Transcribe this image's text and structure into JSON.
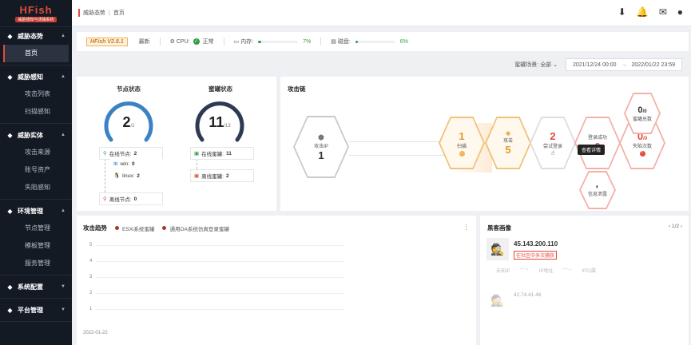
{
  "app": {
    "logo": "HFish",
    "subtitle": "威胁感知与诱捕系统"
  },
  "sidebar": [
    {
      "label": "威胁态势",
      "icon": "dashboard-icon",
      "items": [
        {
          "label": "首页",
          "active": true
        }
      ]
    },
    {
      "label": "威胁感知",
      "icon": "radar-icon",
      "items": [
        {
          "label": "攻击列表"
        },
        {
          "label": "扫描感知"
        }
      ]
    },
    {
      "label": "威胁实体",
      "icon": "target-icon",
      "items": [
        {
          "label": "攻击来源"
        },
        {
          "label": "账号资产"
        },
        {
          "label": "失陷感知"
        }
      ]
    },
    {
      "label": "环境管理",
      "icon": "server-icon",
      "items": [
        {
          "label": "节点管理"
        },
        {
          "label": "模板管理"
        },
        {
          "label": "服务管理"
        }
      ]
    },
    {
      "label": "系统配置",
      "icon": "settings-icon",
      "items": []
    },
    {
      "label": "平台管理",
      "icon": "platform-icon",
      "items": []
    }
  ],
  "breadcrumb": {
    "parent": "威胁态势",
    "current": "首页"
  },
  "status": {
    "version": "HFish V2.8.1",
    "update": "最新",
    "cpu_label": "CPU:",
    "cpu_status": "正常",
    "mem_label": "内存:",
    "mem_pct": "7%",
    "mem_value": 0.07,
    "disk_label": "磁盘:",
    "disk_pct": "6%",
    "disk_value": 0.06
  },
  "filter": {
    "label": "蜜罐场景:",
    "value": "全部",
    "start": "2021/12/24 00:00",
    "arrow": "→",
    "end": "2022/01/22 23:59"
  },
  "nodes": {
    "title": "节点状态",
    "value": "2",
    "total": "/2",
    "online_label": "在线节点:",
    "online": "2",
    "win_label": "win:",
    "win": "0",
    "linux_label": "linux:",
    "linux": "2",
    "offline_label": "离线节点:",
    "offline": "0"
  },
  "honeypots": {
    "title": "蜜罐状态",
    "value": "11",
    "total": "/13",
    "online_label": "在线蜜罐:",
    "online": "11",
    "offline_label": "离线蜜罐:",
    "offline": "2"
  },
  "chain": {
    "title": "攻击链",
    "source_label": "攻击IP",
    "source_value": "1",
    "stages": [
      {
        "label": "扫描",
        "value": "1"
      },
      {
        "label": "攻击",
        "value": "5"
      },
      {
        "label": "尝试登录",
        "value": "2"
      },
      {
        "label": "登录成功",
        "value": "0"
      },
      {
        "label": "失陷次数",
        "value": "0",
        "total": "/0"
      },
      {
        "label": "蜜罐总数",
        "value": "0",
        "total": "/0"
      },
      {
        "label": "信息泄露",
        "value": ""
      }
    ],
    "tooltip": "查看详情"
  },
  "trend": {
    "title": "攻击趋势",
    "legend": [
      "ESXi系统蜜罐",
      "通用OA系统仿真登录蜜罐"
    ],
    "yticks": [
      "5",
      "4",
      "3",
      "2",
      "1"
    ],
    "xlabel": "2022-01-22"
  },
  "attacker": {
    "title": "黑客画像",
    "pager": "1/2",
    "ip": "45.143.200.110",
    "tag": "在社区中多次捕获",
    "ip2": "42.74.41.46",
    "flow": [
      "未知IP",
      "IP地址",
      "IP归属"
    ]
  }
}
